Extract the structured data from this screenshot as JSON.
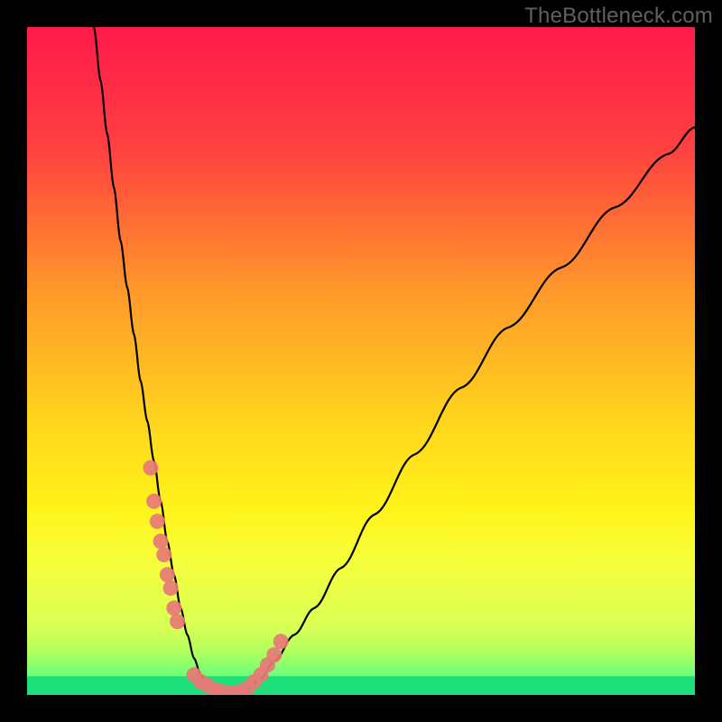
{
  "watermark": "TheBottleneck.com",
  "chart_data": {
    "type": "line",
    "title": "",
    "xlabel": "",
    "ylabel": "",
    "xlim": [
      0,
      100
    ],
    "ylim": [
      0,
      100
    ],
    "grid": false,
    "legend": false,
    "background_gradient": {
      "stops": [
        {
          "offset": 0.0,
          "color": "#ff1a4b"
        },
        {
          "offset": 0.18,
          "color": "#ff4040"
        },
        {
          "offset": 0.4,
          "color": "#ff9a2a"
        },
        {
          "offset": 0.58,
          "color": "#ffd21e"
        },
        {
          "offset": 0.72,
          "color": "#fff31a"
        },
        {
          "offset": 0.8,
          "color": "#f6ff3c"
        },
        {
          "offset": 0.9,
          "color": "#d7ff55"
        },
        {
          "offset": 0.94,
          "color": "#aaff60"
        },
        {
          "offset": 0.97,
          "color": "#6eff7a"
        },
        {
          "offset": 1.0,
          "color": "#23ff8c"
        }
      ]
    },
    "curve": {
      "x": [
        10,
        11,
        12,
        13,
        14,
        15,
        16,
        17,
        18,
        19,
        20,
        21,
        22,
        23,
        24,
        25,
        26,
        27,
        28,
        29,
        30,
        31,
        32,
        33,
        35,
        37,
        40,
        43,
        47,
        52,
        58,
        65,
        72,
        80,
        88,
        96,
        100
      ],
      "y": [
        100,
        92,
        84,
        76,
        68,
        61,
        54,
        47,
        41,
        35,
        29,
        23,
        18,
        13,
        9,
        5.5,
        3,
        1.5,
        0.7,
        0.3,
        0.1,
        0.1,
        0.3,
        0.9,
        2.5,
        5,
        9,
        13,
        19,
        27,
        36,
        46,
        55,
        64,
        73,
        81,
        85
      ]
    },
    "points": {
      "x": [
        18.5,
        19,
        19.5,
        20,
        20.5,
        21,
        21.5,
        22,
        22.5,
        25,
        26,
        27,
        28,
        29,
        30,
        31,
        32,
        33,
        34,
        35,
        36,
        37,
        38
      ],
      "y": [
        34,
        29,
        26,
        23,
        21,
        18,
        16,
        13,
        11,
        3,
        2,
        1.4,
        0.8,
        0.5,
        0.3,
        0.3,
        0.5,
        1,
        2,
        3,
        4.5,
        6,
        8
      ]
    },
    "green_band": {
      "y": 97.5,
      "height": 2.5
    }
  }
}
